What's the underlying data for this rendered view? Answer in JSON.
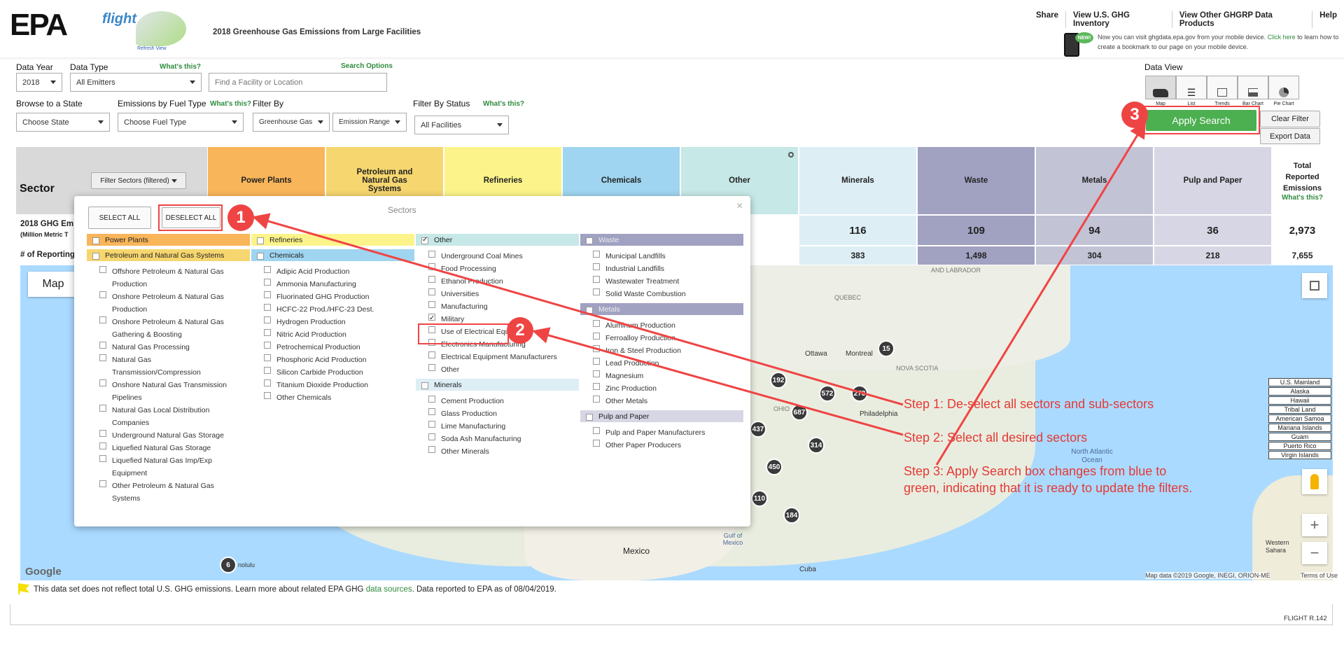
{
  "header": {
    "epa_logo": "EPA",
    "flight_logo": "flight",
    "refresh_view": "Refresh View",
    "page_title": "2018 Greenhouse Gas Emissions from Large Facilities",
    "nav": [
      "Share",
      "View U.S. GHG Inventory",
      "View Other GHGRP Data Products",
      "Help"
    ],
    "mobile_text": "Now you can visit ghgdata.epa.gov from your mobile device.",
    "mobile_link": "Click here",
    "mobile_text2": "to learn how to create a bookmark to our page on your mobile device.",
    "new_badge": "NEW!"
  },
  "filters": {
    "data_year_label": "Data Year",
    "data_year": "2018",
    "data_type_label": "Data Type",
    "whats_this": "What's this?",
    "data_type": "All Emitters",
    "search_options": "Search Options",
    "search_placeholder": "Find a Facility or Location",
    "browse_state_label": "Browse to a State",
    "state": "Choose State",
    "fuel_label": "Emissions by Fuel Type",
    "fuel": "Choose Fuel Type",
    "filter_by_label": "Filter By",
    "greenhouse_gas": "Greenhouse Gas",
    "emission_range": "Emission Range",
    "status_label": "Filter By Status",
    "status": "All Facilities"
  },
  "data_view": {
    "label": "Data View",
    "options": [
      "Map",
      "List",
      "Trends",
      "Bar Chart",
      "Pie Chart"
    ],
    "apply": "Apply Search",
    "clear": "Clear Filter",
    "export": "Export Data"
  },
  "sector_table": {
    "sector_label": "Sector",
    "filter_button": "Filter Sectors (filtered)",
    "sectors": [
      "Power Plants",
      "Petroleum and Natural Gas Systems",
      "Refineries",
      "Chemicals",
      "Other",
      "Minerals",
      "Waste",
      "Metals",
      "Pulp and Paper"
    ],
    "total_label": "Total Reported Emissions",
    "total_whats": "What's this?",
    "row1_label": "2018 GHG Em",
    "row1_sub": "(Million Metric T",
    "row1_values": [
      "116",
      "109",
      "94",
      "36",
      "2,973"
    ],
    "row2_label": "# of Reporting",
    "row2_values": [
      "383",
      "1,498",
      "304",
      "218",
      "7,655"
    ]
  },
  "sectors_modal": {
    "title": "Sectors",
    "select_all": "SELECT ALL",
    "deselect_all": "DESELECT ALL",
    "close": "×",
    "col1": {
      "headers": [
        "Power Plants",
        "Petroleum and Natural Gas Systems"
      ],
      "items": [
        "Offshore Petroleum & Natural Gas Production",
        "Onshore Petroleum & Natural Gas Production",
        "Onshore Petroleum & Natural Gas Gathering & Boosting",
        "Natural Gas Processing",
        "Natural Gas Transmission/Compression",
        "Onshore Natural Gas Transmission Pipelines",
        "Natural Gas Local Distribution Companies",
        "Underground Natural Gas Storage",
        "Liquefied Natural Gas Storage",
        "Liquefied Natural Gas Imp/Exp Equipment",
        "Other Petroleum & Natural Gas Systems"
      ]
    },
    "col2": {
      "headers": [
        "Refineries",
        "Chemicals"
      ],
      "items": [
        "Adipic Acid Production",
        "Ammonia Manufacturing",
        "Fluorinated GHG Production",
        "HCFC-22 Prod./HFC-23 Dest.",
        "Hydrogen Production",
        "Nitric Acid Production",
        "Petrochemical Production",
        "Phosphoric Acid Production",
        "Silicon Carbide Production",
        "Titanium Dioxide Production",
        "Other Chemicals"
      ]
    },
    "col3": {
      "header": "Other",
      "items": [
        "Underground Coal Mines",
        "Food Processing",
        "Ethanol Production",
        "Universities",
        "Manufacturing",
        "Military",
        "Use of Electrical Equipment",
        "Electronics Manufacturing",
        "Electrical Equipment Manufacturers",
        "Other"
      ],
      "header2": "Minerals",
      "items2": [
        "Cement Production",
        "Glass Production",
        "Lime Manufacturing",
        "Soda Ash Manufacturing",
        "Other Minerals"
      ]
    },
    "col4": {
      "header": "Waste",
      "items": [
        "Municipal Landfills",
        "Industrial Landfills",
        "Wastewater Treatment",
        "Solid Waste Combustion"
      ],
      "header2": "Metals",
      "items2": [
        "Aluminum Production",
        "Ferroalloy Production",
        "Iron & Steel Production",
        "Lead Production",
        "Magnesium",
        "Zinc Production",
        "Other Metals"
      ],
      "header3": "Pulp and Paper",
      "items3": [
        "Pulp and Paper Manufacturers",
        "Other Paper Producers"
      ]
    }
  },
  "map": {
    "map_button": "Map",
    "labels": [
      "Ottawa",
      "Montreal",
      "QUEBEC",
      "AND LABRADOR",
      "NOVA SCOTIA",
      "Philadelphia",
      "OHIO",
      "North Atlantic Ocean",
      "Gulf of Mexico",
      "Mexico",
      "Cuba",
      "Western Sahara",
      "Google",
      "Map data ©2019 Google, INEGI, ORION-ME",
      "Terms of Use",
      "nolulu"
    ],
    "pins": [
      "15",
      "192",
      "572",
      "273",
      "687",
      "437",
      "314",
      "450",
      "110",
      "184",
      "6"
    ],
    "territories": [
      "U.S. Mainland",
      "Alaska",
      "Hawaii",
      "Tribal Land",
      "American Samoa",
      "Mariana Islands",
      "Guam",
      "Puerto Rico",
      "Virgin Islands"
    ]
  },
  "annotations": {
    "badges": [
      "1",
      "2",
      "3"
    ],
    "step1": "Step 1: De-select all sectors and sub-sectors",
    "step2": "Step 2: Select all desired sectors",
    "step3a": "Step 3: Apply Search box changes from blue to",
    "step3b": "green, indicating that it is ready to update the filters."
  },
  "footer": {
    "note": "This data set does not reflect total U.S. GHG emissions. Learn more about related EPA GHG",
    "link": "data sources",
    "note2": ". Data reported to EPA as of 08/04/2019.",
    "version": "FLIGHT R.142"
  },
  "colors": {
    "power": "#f9b55a",
    "petro": "#f6d66f",
    "refineries": "#fcf48a",
    "chemicals": "#9fd5f0",
    "other": "#c6e8e6",
    "minerals": "#ddeef5",
    "waste": "#a1a1c2",
    "metals": "#c3c3d6",
    "pulp": "#d6d6e4",
    "apply": "#4caf50",
    "annotation": "#ef4444"
  }
}
